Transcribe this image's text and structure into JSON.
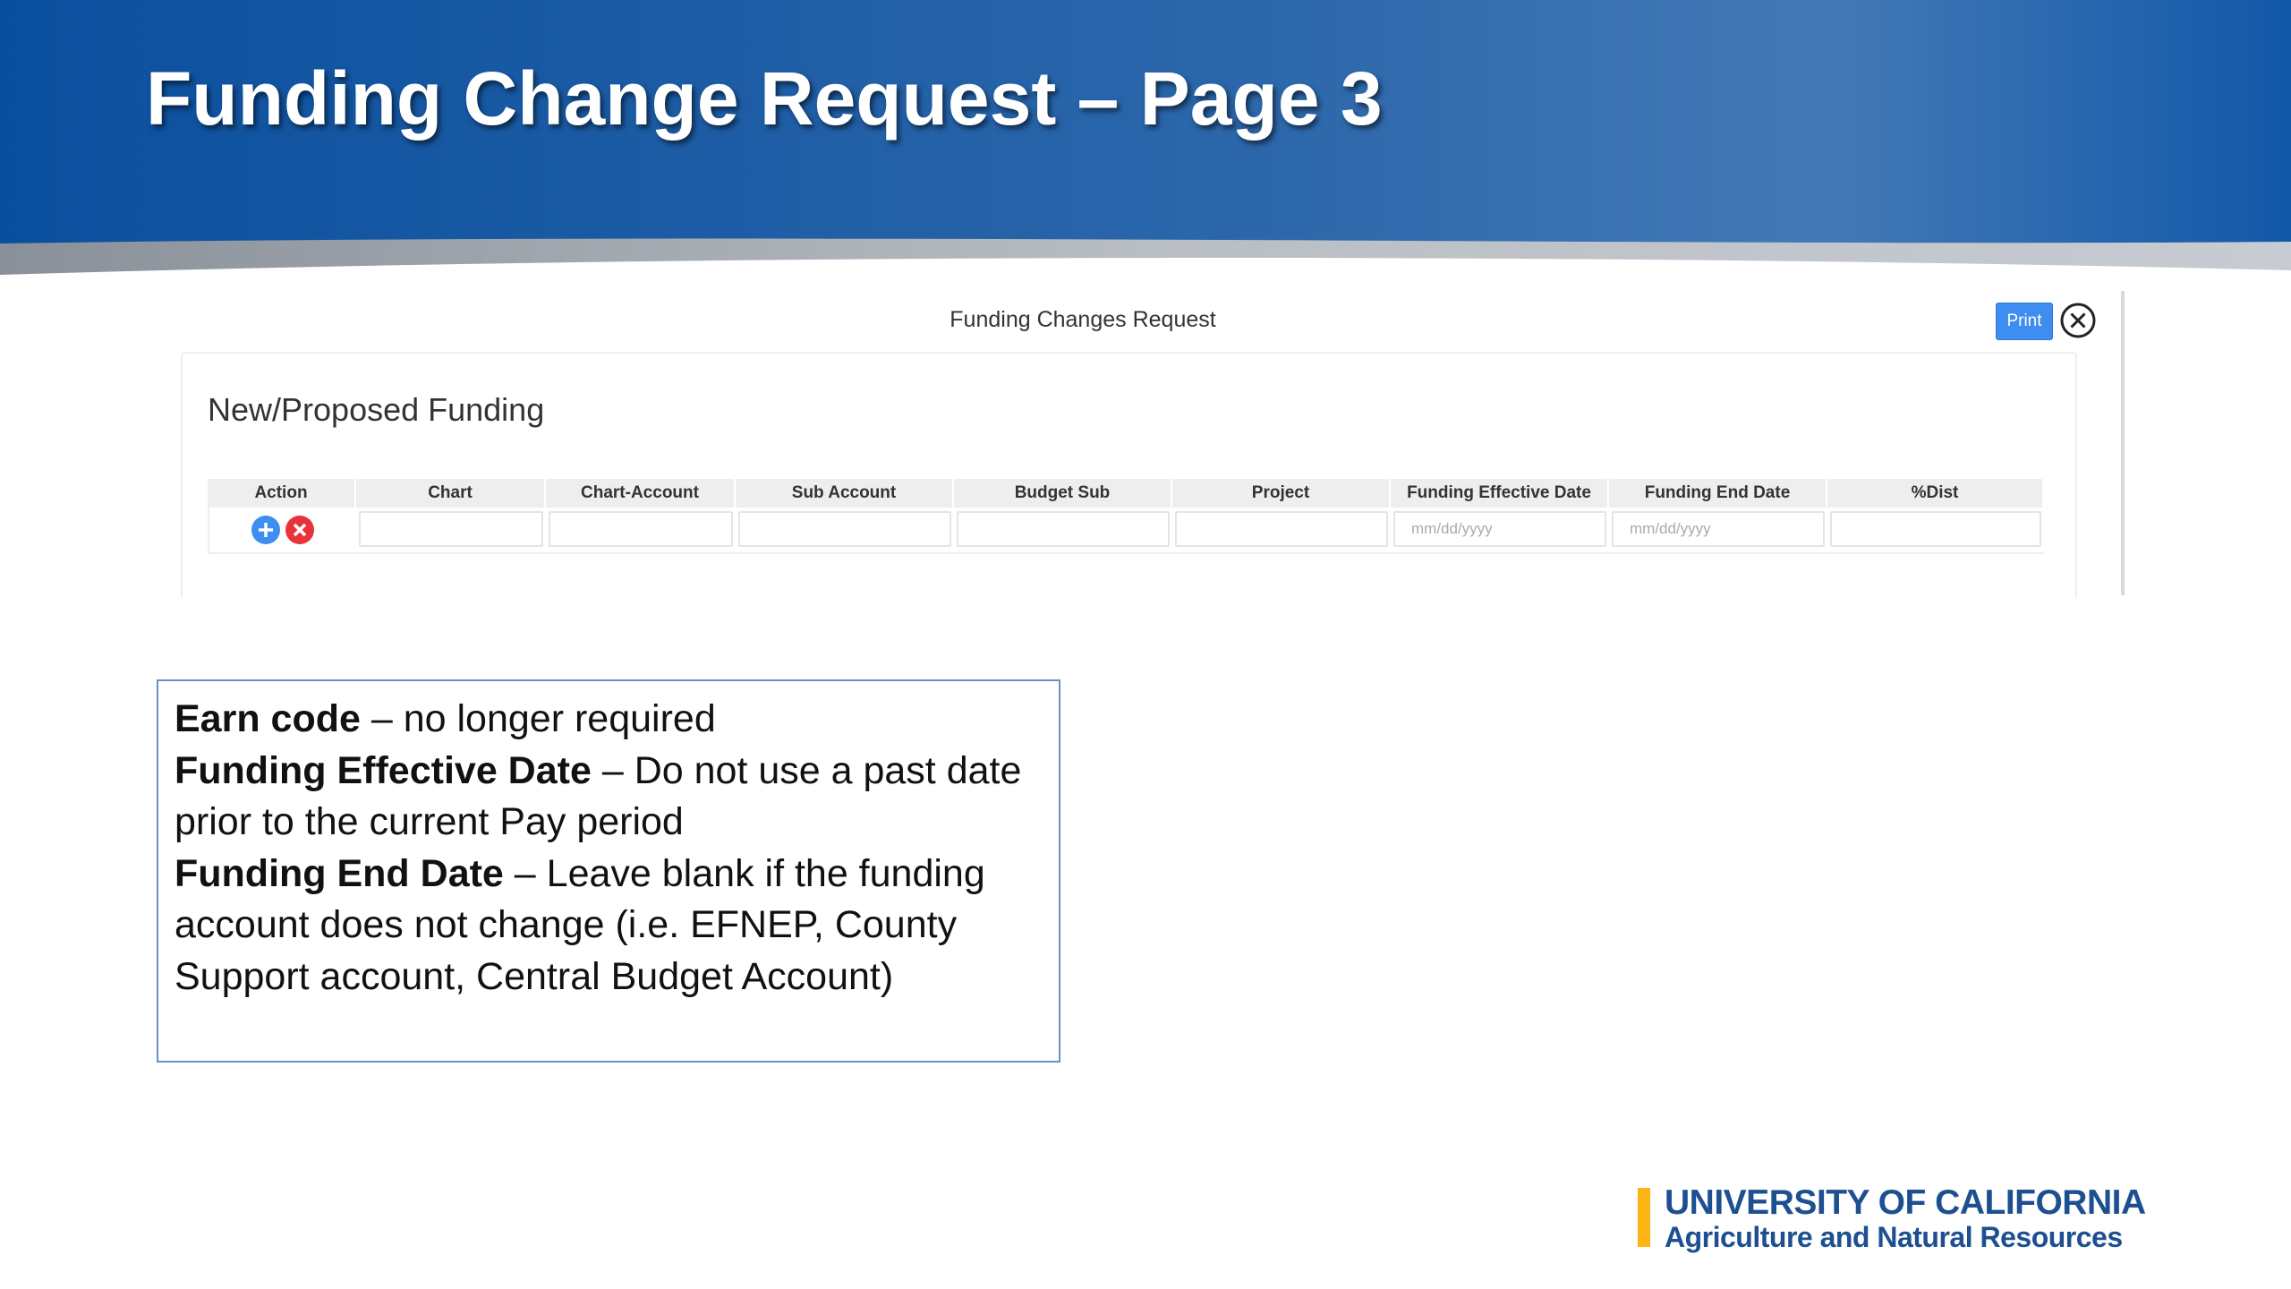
{
  "slide": {
    "title": "Funding Change Request – Page 3"
  },
  "modal": {
    "title": "Funding Changes Request",
    "print_label": "Print",
    "close_icon": "circle-x-icon",
    "section_heading": "New/Proposed Funding",
    "columns": [
      "Action",
      "Chart",
      "Chart-Account",
      "Sub Account",
      "Budget Sub",
      "Project",
      "Funding Effective Date",
      "Funding End Date",
      "%Dist"
    ],
    "row": {
      "add_icon": "plus-circle-icon",
      "remove_icon": "x-circle-icon",
      "chart": "",
      "chart_account": "",
      "sub_account": "",
      "budget_sub": "",
      "project": "",
      "effective_date_placeholder": "mm/dd/yyyy",
      "end_date_placeholder": "mm/dd/yyyy",
      "dist": ""
    }
  },
  "notes": {
    "earn_code_label": "Earn code",
    "earn_code_text": " – no longer required",
    "effective_label": "Funding Effective Date",
    "effective_text": " – Do not use a past date prior to the current Pay period",
    "end_label": "Funding End Date",
    "end_text": " – Leave blank if the funding account does not change (i.e. EFNEP, County Support account, Central Budget Account)"
  },
  "logo": {
    "line1": "UNIVERSITY OF CALIFORNIA",
    "line2": "Agriculture and Natural Resources"
  },
  "colors": {
    "banner_dark": "#0a4f9e",
    "banner_light": "#3d78b8",
    "accent_blue": "#3d8ef0",
    "remove_red": "#e8333a",
    "logo_blue": "#1d4f91",
    "logo_gold": "#fdb515"
  }
}
